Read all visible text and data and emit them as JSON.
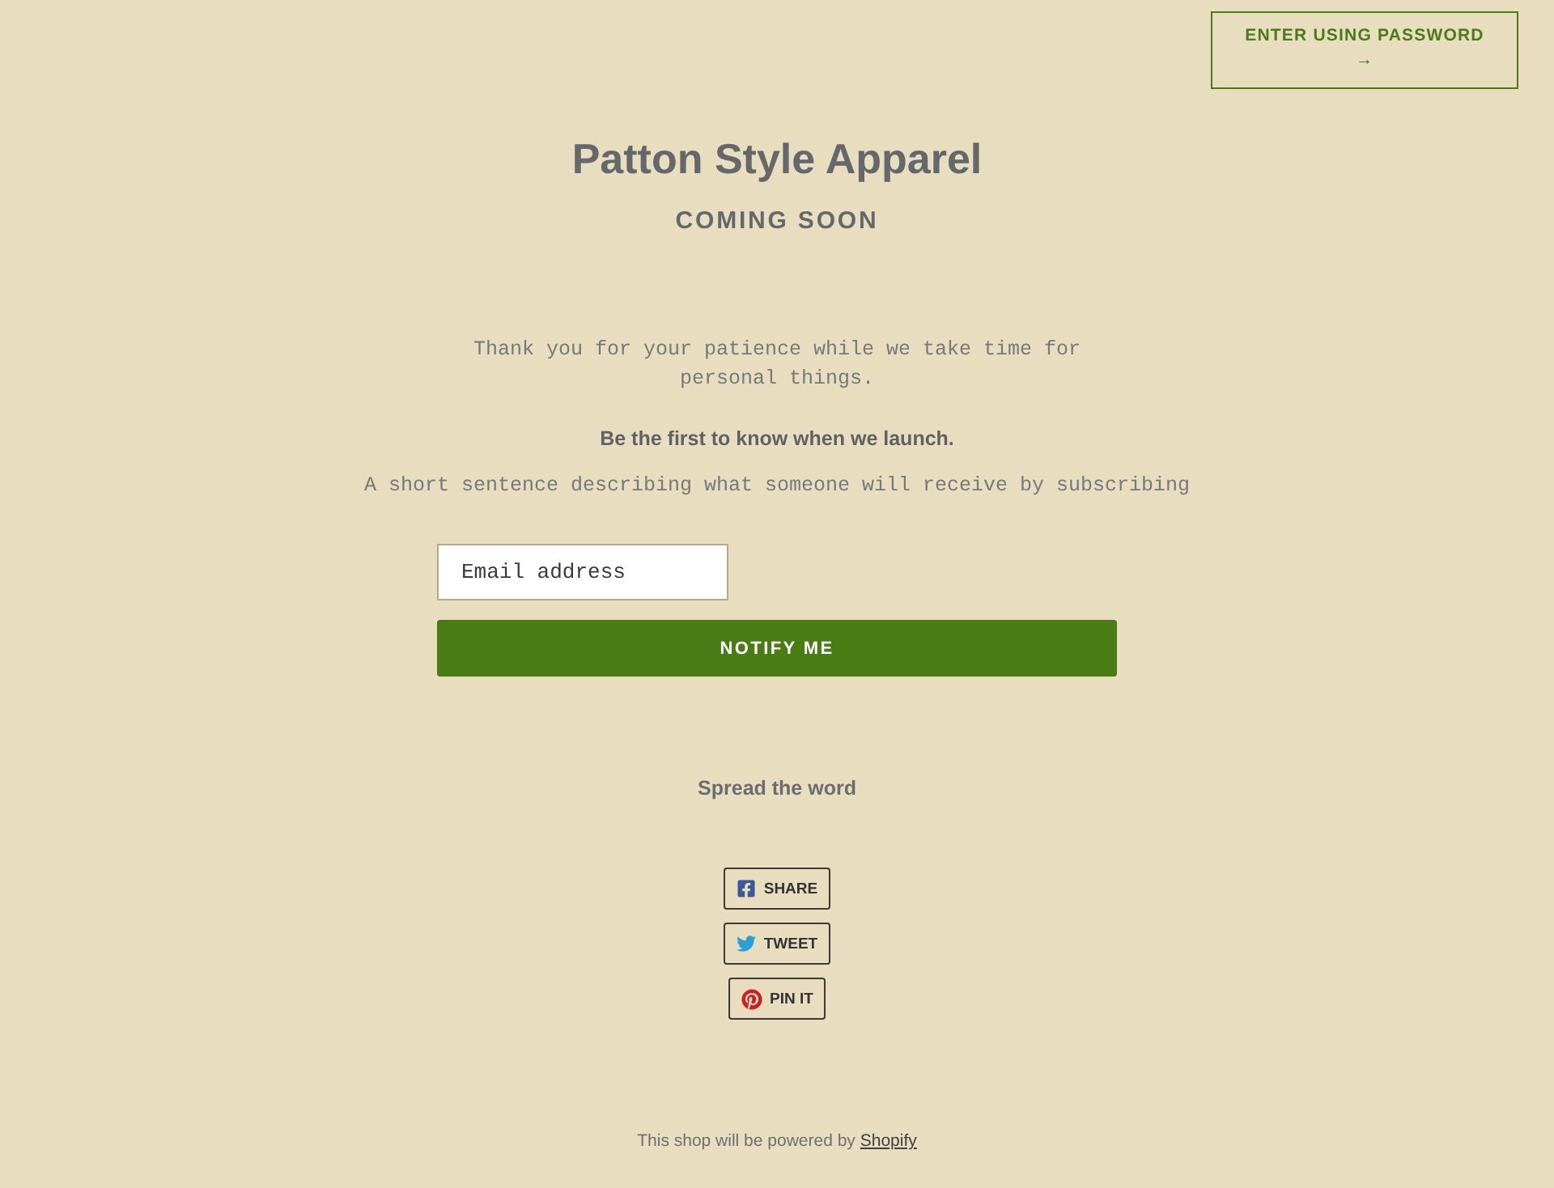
{
  "header": {
    "password_button": {
      "label": "ENTER USING PASSWORD",
      "arrow": "→"
    }
  },
  "store": {
    "title": "Patton Style Apparel",
    "subtitle": "COMING SOON"
  },
  "intro": {
    "message": "Thank you for your patience while we take time for personal things.",
    "heading": "Be the first to know when we launch.",
    "description": "A short sentence describing what someone will receive by subscribing"
  },
  "signup": {
    "email": {
      "placeholder": "Email address"
    },
    "button": "NOTIFY ME"
  },
  "share": {
    "heading": "Spread the word",
    "buttons": [
      {
        "kind": "facebook",
        "label": "SHARE"
      },
      {
        "kind": "twitter",
        "label": "TWEET"
      },
      {
        "kind": "pinterest",
        "label": "PIN IT"
      }
    ]
  },
  "footer": {
    "text": "This shop will be powered by",
    "link": "Shopify"
  }
}
